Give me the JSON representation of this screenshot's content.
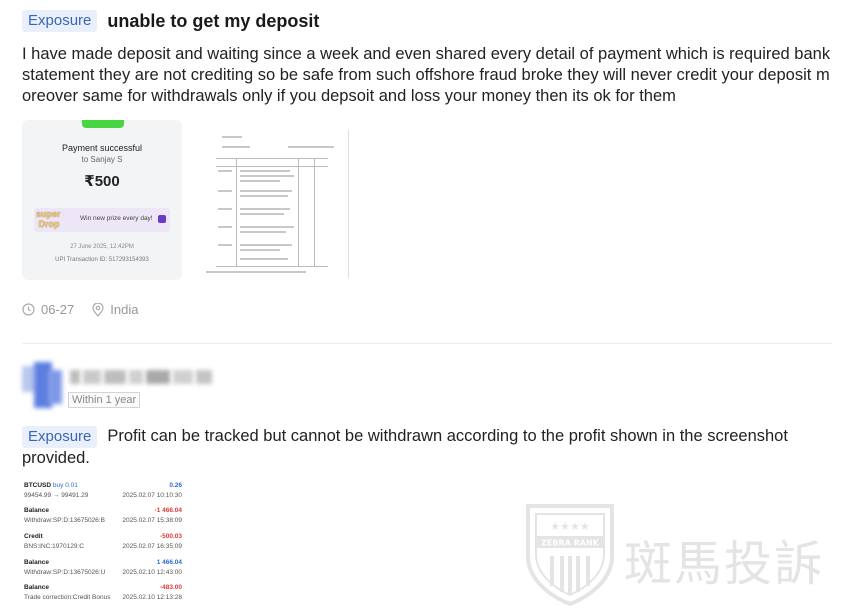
{
  "post1": {
    "tag": "Exposure",
    "title": "unable to get my deposit",
    "body": "I have made deposit and waiting since a week and even shared every detail of payment which is required bank statement they are not crediting so be safe from such offshore fraud broke they will never credit your deposit moreover same for withdrawals only if you depsoit and loss your money then its ok for them",
    "image1": {
      "title": "Payment successful",
      "to": "to Sanjay S",
      "amount": "₹500",
      "promo_logo": "Super Drop",
      "promo_text": "Win new prize every day!",
      "date": "27 June 2025, 12:42PM",
      "txn": "UPI Transaction ID: 517293154393"
    },
    "meta": {
      "date": "06-27",
      "location": "India"
    }
  },
  "post2": {
    "user_badge": "Within 1 year",
    "tag": "Exposure",
    "body": "Profit can be tracked but cannot be withdrawn according to the profit shown in the screenshot provided.",
    "image": {
      "rows": [
        {
          "label_prefix": "BTCUSD",
          "label_suffix": "buy 0.01",
          "value": "0.26",
          "value_color": "blue",
          "sub": "99454.99 → 99491.29",
          "date": "2025.02.07 10:10:30"
        },
        {
          "label": "Balance",
          "value": "-1 466.04",
          "value_color": "red",
          "sub": "Withdraw:SP:D:13675026:B",
          "date": "2025.02.07 15:38:09"
        },
        {
          "label": "Credit",
          "value": "-500.03",
          "value_color": "red",
          "sub": "BNS:INC:1970129:C",
          "date": "2025.02.07 16:35:09"
        },
        {
          "label": "Balance",
          "value": "1 466.04",
          "value_color": "blue",
          "sub": "Withdraw:SP:D:13675026:U",
          "date": "2025.02.10 12:43:00"
        },
        {
          "label": "Balance",
          "value": "-483.00",
          "value_color": "red",
          "sub": "Trade correction:Credit Bonus",
          "date": "2025.02.10 12:13:28"
        }
      ]
    }
  },
  "watermark": {
    "badge_text": "ZEBRA RANK",
    "text": "斑馬投訴"
  },
  "colors": {
    "tag_bg": "#e9effb",
    "tag_text": "#3a66b8",
    "negative": "#e03a3a",
    "positive": "#2a6ad6"
  }
}
